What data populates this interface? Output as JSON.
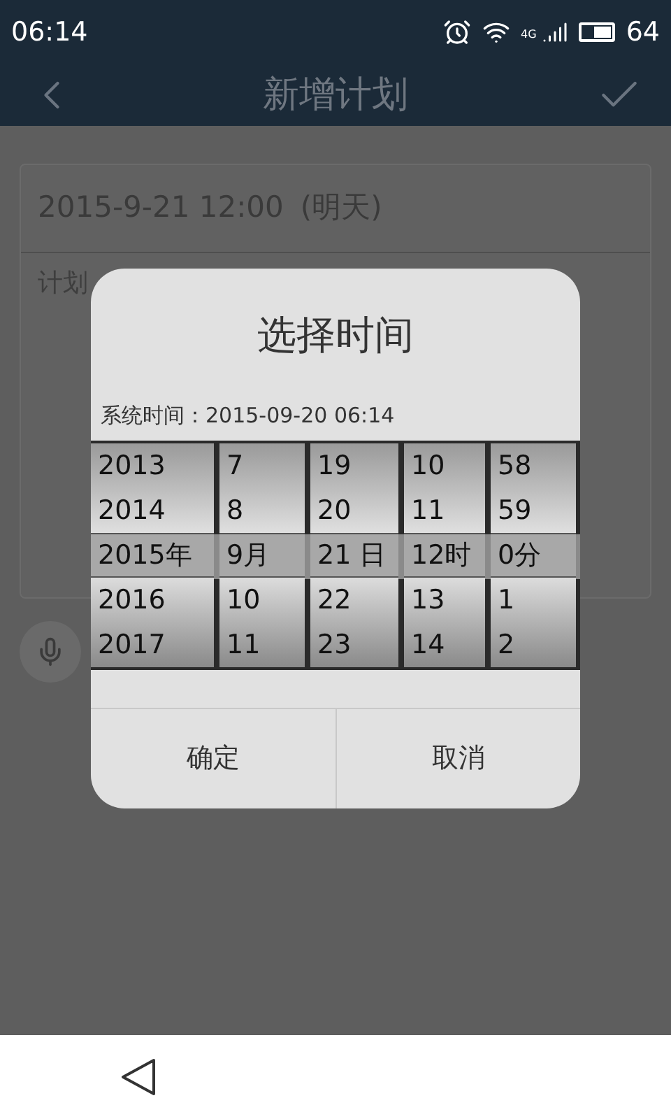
{
  "status_bar": {
    "time": "06:14",
    "network": "4G",
    "battery": "64"
  },
  "header": {
    "title": "新增计划"
  },
  "form": {
    "date": "2015-9-21 12:00",
    "relative_day": "(明天)",
    "content_placeholder": "计划"
  },
  "dialog": {
    "title": "选择时间",
    "system_time_label": "系统时间：",
    "system_time": "2015-09-20 06:14",
    "wheels": [
      {
        "items": [
          {
            "label": "2013",
            "selected": false
          },
          {
            "label": "2014",
            "selected": false
          },
          {
            "label": "2015年",
            "selected": true
          },
          {
            "label": "2016",
            "selected": false
          },
          {
            "label": "2017",
            "selected": false
          }
        ]
      },
      {
        "items": [
          {
            "label": "7",
            "selected": false
          },
          {
            "label": "8",
            "selected": false
          },
          {
            "label": "9月",
            "selected": true
          },
          {
            "label": "10",
            "selected": false
          },
          {
            "label": "11",
            "selected": false
          }
        ]
      },
      {
        "items": [
          {
            "label": "19",
            "selected": false
          },
          {
            "label": "20",
            "selected": false
          },
          {
            "label": "21 日",
            "selected": true
          },
          {
            "label": "22",
            "selected": false
          },
          {
            "label": "23",
            "selected": false
          }
        ]
      },
      {
        "items": [
          {
            "label": "10",
            "selected": false
          },
          {
            "label": "11",
            "selected": false
          },
          {
            "label": "12时",
            "selected": true
          },
          {
            "label": "13",
            "selected": false
          },
          {
            "label": "14",
            "selected": false
          }
        ]
      },
      {
        "items": [
          {
            "label": "58",
            "selected": false
          },
          {
            "label": "59",
            "selected": false
          },
          {
            "label": "0分",
            "selected": true
          },
          {
            "label": "1",
            "selected": false
          },
          {
            "label": "2",
            "selected": false
          }
        ]
      }
    ],
    "buttons": [
      "确定",
      "取消"
    ]
  }
}
